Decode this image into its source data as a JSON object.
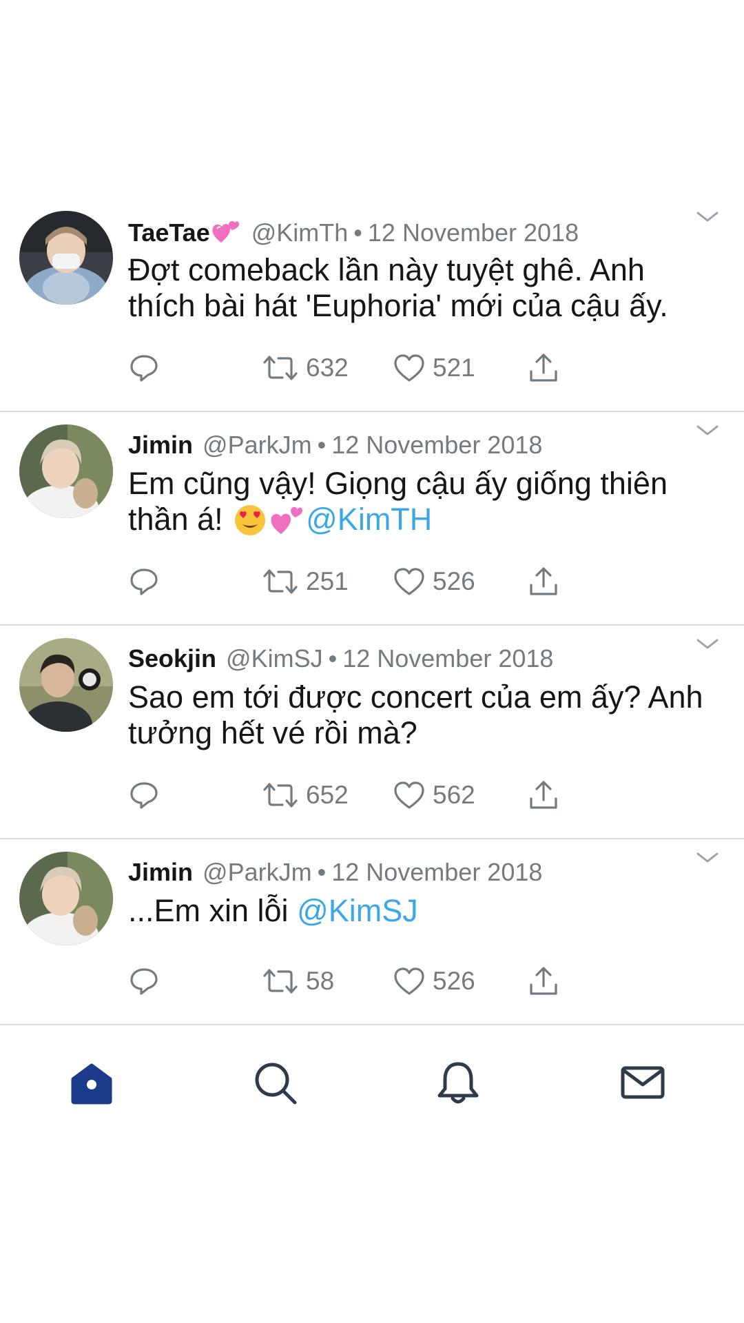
{
  "tweets": [
    {
      "name": "TaeTae",
      "name_emoji": "heart-emoji",
      "handle": "@KimTh",
      "separator": "•",
      "date": "12 November 2018",
      "text": "Đợt comeback lần này tuyệt ghê. Anh thích bài hát 'Euphoria' mới của cậu ấy.",
      "mention": "",
      "replies": "",
      "retweets": "632",
      "likes": "521"
    },
    {
      "name": "Jimin",
      "handle": "@ParkJm",
      "separator": "•",
      "date": "12 November 2018",
      "text": "Em cũng vậy! Giọng cậu ấy giống thiên thần á! ",
      "emojis": [
        "heart-eyes-emoji",
        "two-hearts-emoji"
      ],
      "mention": "@KimTH",
      "replies": "",
      "retweets": "251",
      "likes": "526"
    },
    {
      "name": "Seokjin",
      "handle": "@KimSJ",
      "separator": "•",
      "date": "12 November 2018",
      "text": "Sao em tới được concert của em ấy? Anh tưởng hết vé rồi mà?",
      "mention": "",
      "replies": "",
      "retweets": "652",
      "likes": "562"
    },
    {
      "name": "Jimin",
      "handle": "@ParkJm",
      "separator": "•",
      "date": "12 November 2018",
      "text": "...Em xin lỗi ",
      "mention": "@KimSJ",
      "replies": "",
      "retweets": "58",
      "likes": "526"
    }
  ],
  "tabbar": {
    "items": [
      "home-icon",
      "search-icon",
      "notifications-icon",
      "messages-icon"
    ],
    "active": "home-icon",
    "active_color": "#1a3a8a"
  },
  "colors": {
    "mention": "#3aa8e8",
    "meta": "#737a80",
    "divider": "#d9dde0"
  }
}
